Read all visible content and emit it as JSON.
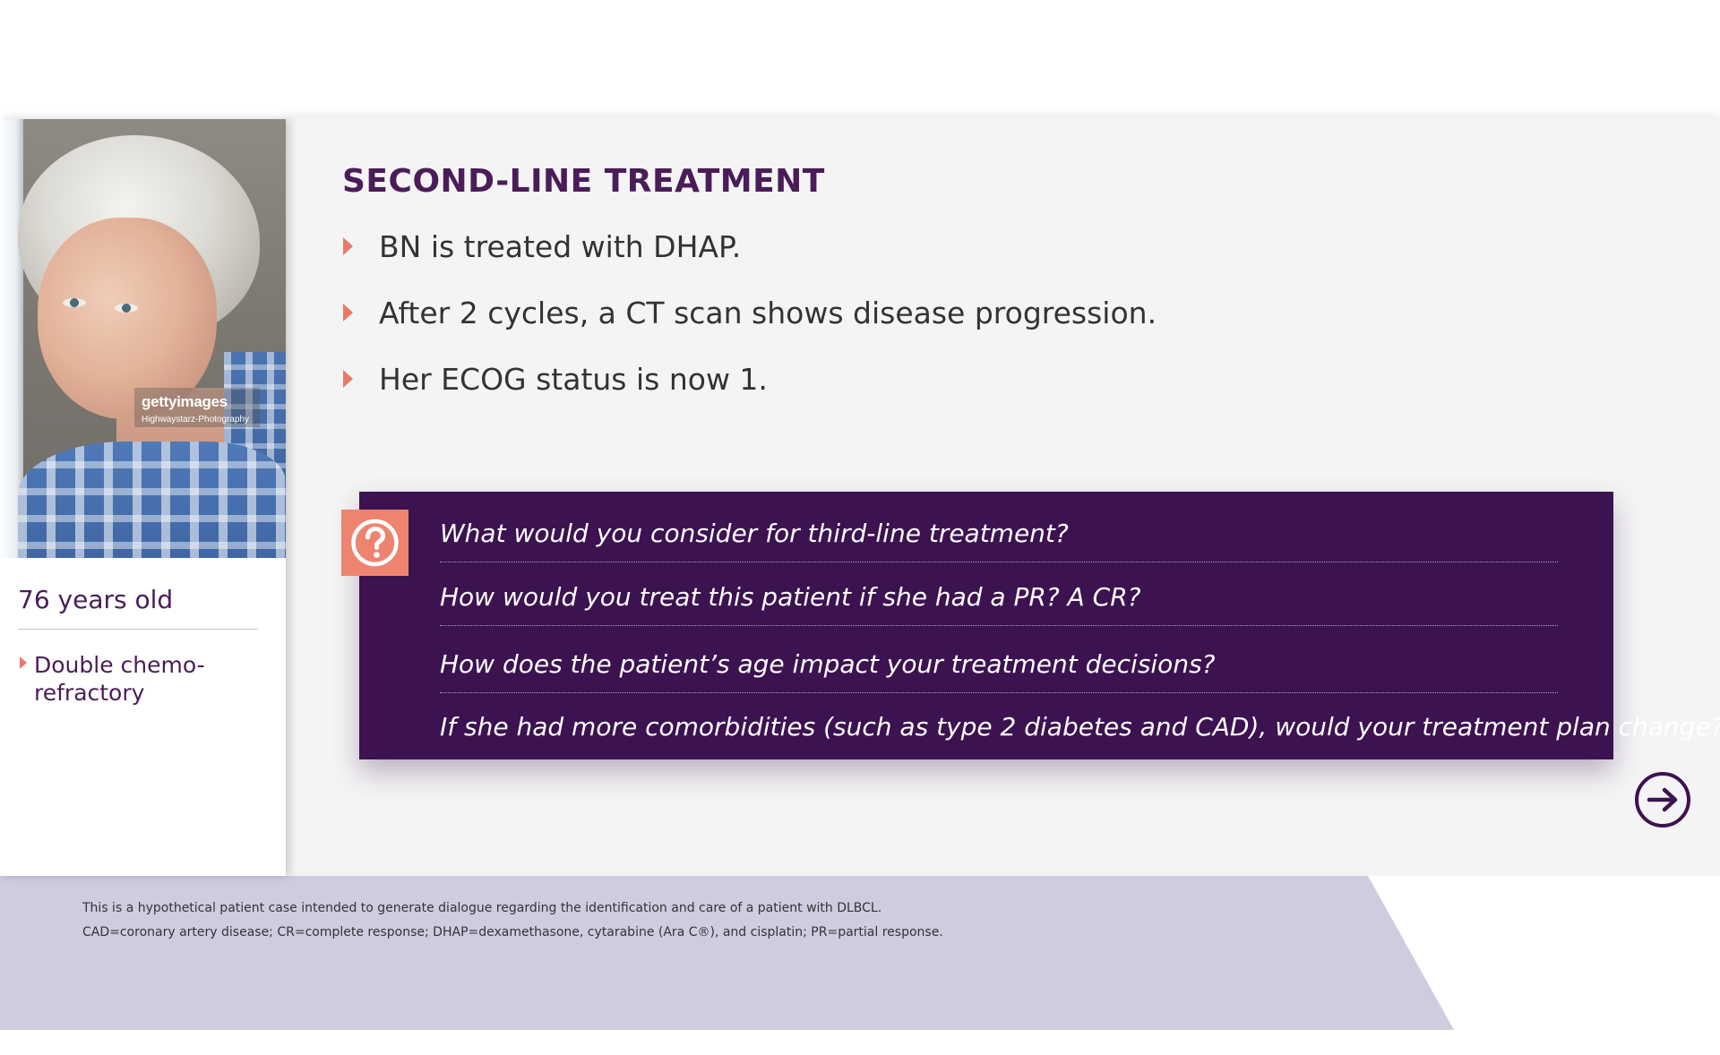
{
  "slide": {
    "title": "SECOND-LINE TREATMENT",
    "bullets": [
      "BN is treated with DHAP.",
      "After 2 cycles, a CT scan shows disease progression.",
      "Her ECOG status is now 1."
    ]
  },
  "patient": {
    "photo_watermark": "gettyimages",
    "photo_credit": "Highwaystarz-Photography",
    "age": "76 years old",
    "tags": [
      "Double chemo-refractory"
    ]
  },
  "discussion": {
    "icon": "question-mark-icon",
    "questions": [
      "What would you consider for third-line treatment?",
      "How would you treat this patient if she had a PR? A CR?",
      "How does the patient’s age impact your treatment decisions?",
      "If she had more comorbidities (such as type 2 diabetes and CAD), would your treatment plan change?"
    ]
  },
  "navigation": {
    "next_icon": "arrow-right-circle-icon"
  },
  "footer": {
    "disclaimer": "This is a hypothetical patient case intended to generate dialogue regarding the identification and care of a patient with DLBCL.",
    "abbreviations": "CAD=coronary artery disease; CR=complete response; DHAP=dexamethasone, cytarabine (Ara C®), and cisplatin; PR=partial response."
  },
  "colors": {
    "brand_purple": "#4a1c58",
    "question_box": "#3c1250",
    "accent_coral": "#ee8470",
    "footer_lavender": "#cfcce0",
    "content_background": "#f4f4f4"
  }
}
